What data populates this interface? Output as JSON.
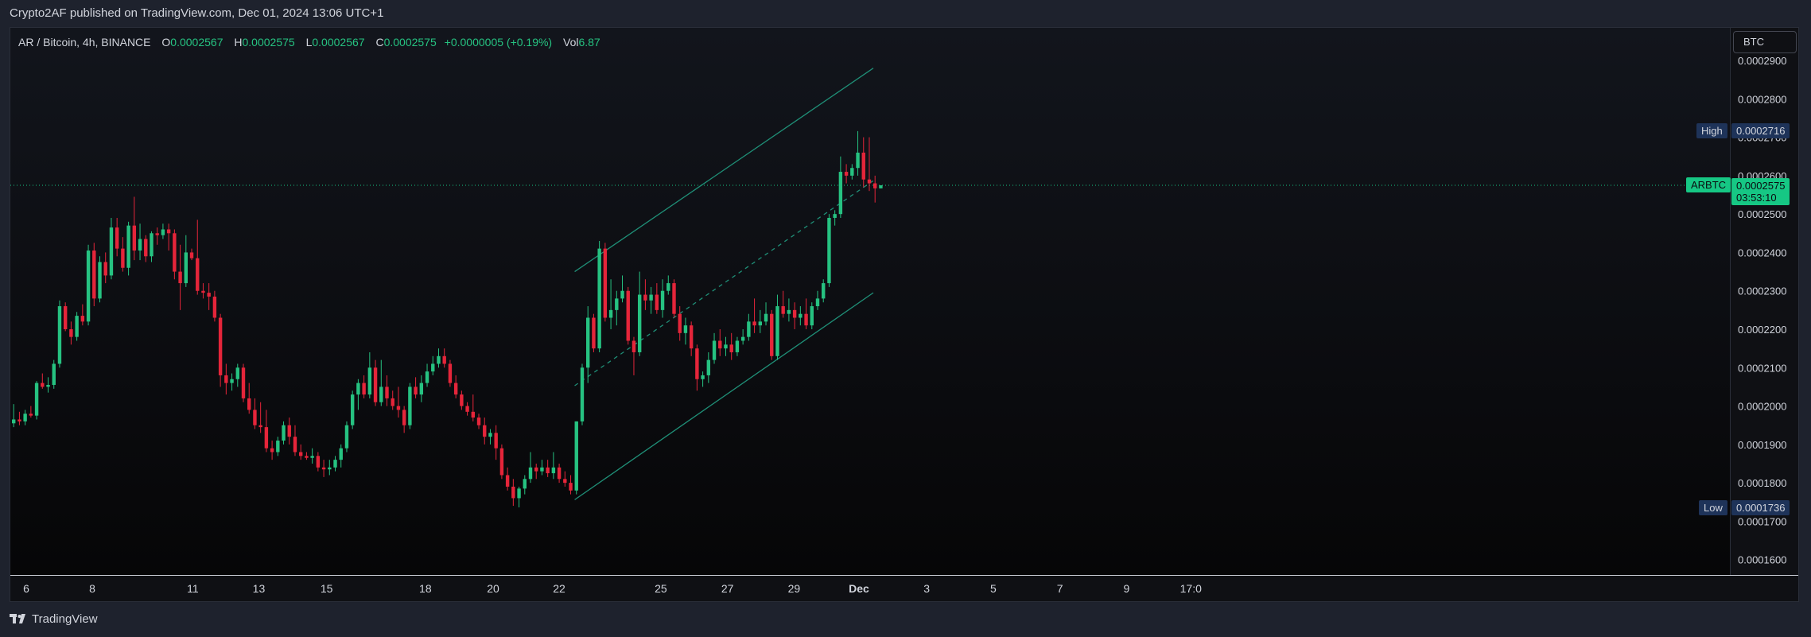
{
  "header": {
    "publish_text": "Crypto2AF published on TradingView.com, Dec 01, 2024 13:06 UTC+1"
  },
  "legend": {
    "symbol": "AR / Bitcoin, 4h, BINANCE",
    "open_label": "O",
    "open": "0.0002567",
    "high_label": "H",
    "high": "0.0002575",
    "low_label": "L",
    "low": "0.0002567",
    "close_label": "C",
    "close": "0.0002575",
    "change": "+0.0000005 (+0.19%)",
    "vol_label": "Vol",
    "vol": "6.87"
  },
  "price_axis": {
    "unit_button": "BTC"
  },
  "markers": {
    "high_label": "High",
    "high_value": "0.0002716",
    "low_label": "Low",
    "low_value": "0.0001736",
    "last_label": "ARBTC",
    "last_value": "0.0002575",
    "countdown": "03:53:10"
  },
  "colors": {
    "up": "#26c281",
    "down": "#e5253a",
    "channel": "#1f8f77",
    "last_price": "#16c784",
    "marker_bg": "#1e3359"
  },
  "footer": {
    "brand": "TradingView"
  },
  "chart_data": {
    "type": "candlestick",
    "interval": "4h",
    "symbol": "ARBTC",
    "ylim": [
      0.000156,
      0.0002985
    ],
    "y_ticks": [
      "0.0002900",
      "0.0002800",
      "0.0002700",
      "0.0002600",
      "0.0002500",
      "0.0002400",
      "0.0002300",
      "0.0002200",
      "0.0002100",
      "0.0002000",
      "0.0001900",
      "0.0001800",
      "0.0001700",
      "0.0001600"
    ],
    "x_ticks": [
      "6",
      "8",
      "11",
      "13",
      "15",
      "18",
      "20",
      "22",
      "25",
      "27",
      "29",
      "Dec",
      "3",
      "5",
      "7",
      "9",
      "17:0"
    ],
    "high": 0.0002716,
    "low": 0.0001736,
    "last": 0.0002575,
    "grid": false,
    "candles": [
      [
        0.0001955,
        0.0002005,
        0.0001945,
        0.0001965
      ],
      [
        0.0001965,
        0.0001985,
        0.000195,
        0.000196
      ],
      [
        0.000196,
        0.000199,
        0.000195,
        0.000198
      ],
      [
        0.000198,
        0.0002,
        0.000197,
        0.0001975
      ],
      [
        0.0001975,
        0.0002065,
        0.0001965,
        0.000206
      ],
      [
        0.000206,
        0.0002085,
        0.0002045,
        0.000205
      ],
      [
        0.000205,
        0.0002075,
        0.0002035,
        0.0002055
      ],
      [
        0.0002055,
        0.000212,
        0.0002045,
        0.000211
      ],
      [
        0.000211,
        0.0002275,
        0.00021,
        0.000226
      ],
      [
        0.000226,
        0.000227,
        0.0002195,
        0.00022
      ],
      [
        0.00022,
        0.000222,
        0.000216,
        0.000218
      ],
      [
        0.000218,
        0.0002245,
        0.000217,
        0.0002235
      ],
      [
        0.0002235,
        0.0002265,
        0.000221,
        0.000222
      ],
      [
        0.000222,
        0.000242,
        0.000221,
        0.0002405
      ],
      [
        0.0002405,
        0.0002425,
        0.000226,
        0.000228
      ],
      [
        0.000228,
        0.000239,
        0.000227,
        0.0002375
      ],
      [
        0.0002375,
        0.00024,
        0.000232,
        0.000234
      ],
      [
        0.000234,
        0.000249,
        0.000233,
        0.0002465
      ],
      [
        0.0002465,
        0.000249,
        0.000239,
        0.000241
      ],
      [
        0.000241,
        0.000244,
        0.000235,
        0.000236
      ],
      [
        0.000236,
        0.000248,
        0.000234,
        0.000247
      ],
      [
        0.000247,
        0.0002545,
        0.000238,
        0.0002405
      ],
      [
        0.0002405,
        0.0002475,
        0.000238,
        0.0002435
      ],
      [
        0.0002435,
        0.0002445,
        0.0002375,
        0.000239
      ],
      [
        0.000239,
        0.0002455,
        0.0002375,
        0.000245
      ],
      [
        0.000245,
        0.0002465,
        0.000242,
        0.0002445
      ],
      [
        0.0002445,
        0.0002475,
        0.0002435,
        0.000246
      ],
      [
        0.000246,
        0.0002475,
        0.0002405,
        0.000245
      ],
      [
        0.000245,
        0.000246,
        0.000233,
        0.000235
      ],
      [
        0.000235,
        0.000242,
        0.000225,
        0.000232
      ],
      [
        0.000232,
        0.0002445,
        0.000231,
        0.00024
      ],
      [
        0.00024,
        0.000241,
        0.000238,
        0.0002385
      ],
      [
        0.0002385,
        0.0002485,
        0.000229,
        0.00023
      ],
      [
        0.00023,
        0.000232,
        0.000228,
        0.0002295
      ],
      [
        0.0002295,
        0.000232,
        0.000225,
        0.0002285
      ],
      [
        0.0002285,
        0.00023,
        0.000222,
        0.000223
      ],
      [
        0.000223,
        0.000224,
        0.000205,
        0.000208
      ],
      [
        0.000208,
        0.000211,
        0.000203,
        0.000206
      ],
      [
        0.000206,
        0.0002085,
        0.000204,
        0.000207
      ],
      [
        0.000207,
        0.000211,
        0.000205,
        0.00021
      ],
      [
        0.00021,
        0.000211,
        0.000201,
        0.000202
      ],
      [
        0.000202,
        0.000206,
        0.000198,
        0.000199
      ],
      [
        0.000199,
        0.000202,
        0.000194,
        0.000195
      ],
      [
        0.000195,
        0.000201,
        0.000193,
        0.0001945
      ],
      [
        0.0001945,
        0.000199,
        0.000188,
        0.000189
      ],
      [
        0.000189,
        0.000191,
        0.000186,
        0.000188
      ],
      [
        0.000188,
        0.000192,
        0.000187,
        0.000191
      ],
      [
        0.000191,
        0.000196,
        0.00019,
        0.000195
      ],
      [
        0.000195,
        0.000197,
        0.00019,
        0.000192
      ],
      [
        0.000192,
        0.000195,
        0.000187,
        0.000188
      ],
      [
        0.000188,
        0.00019,
        0.000186,
        0.000187
      ],
      [
        0.000187,
        0.000188,
        0.000186,
        0.0001865
      ],
      [
        0.0001865,
        0.000189,
        0.000185,
        0.000187
      ],
      [
        0.000187,
        0.000188,
        0.000183,
        0.000184
      ],
      [
        0.000184,
        0.000186,
        0.0001815,
        0.0001835
      ],
      [
        0.0001835,
        0.000186,
        0.000182,
        0.000184
      ],
      [
        0.000184,
        0.000187,
        0.000183,
        0.000186
      ],
      [
        0.000186,
        0.00019,
        0.000184,
        0.000189
      ],
      [
        0.000189,
        0.000196,
        0.000188,
        0.000195
      ],
      [
        0.000195,
        0.000204,
        0.000194,
        0.000203
      ],
      [
        0.000203,
        0.000207,
        0.000199,
        0.000206
      ],
      [
        0.000206,
        0.000208,
        0.000202,
        0.000203
      ],
      [
        0.000203,
        0.000214,
        0.000202,
        0.00021
      ],
      [
        0.00021,
        0.000212,
        0.0002,
        0.000201
      ],
      [
        0.000201,
        0.000212,
        0.0002,
        0.000205
      ],
      [
        0.000205,
        0.000208,
        0.0002,
        0.000202
      ],
      [
        0.000202,
        0.000204,
        0.000199,
        0.0002
      ],
      [
        0.0002,
        0.000205,
        0.000197,
        0.000199
      ],
      [
        0.000199,
        0.0002,
        0.000193,
        0.000195
      ],
      [
        0.000195,
        0.000206,
        0.000194,
        0.000205
      ],
      [
        0.000205,
        0.0002075,
        0.000202,
        0.000203
      ],
      [
        0.000203,
        0.000208,
        0.000201,
        0.000206
      ],
      [
        0.000206,
        0.000211,
        0.000205,
        0.000209
      ],
      [
        0.000209,
        0.000213,
        0.000208,
        0.000211
      ],
      [
        0.000211,
        0.000215,
        0.00021,
        0.000213
      ],
      [
        0.000213,
        0.000215,
        0.00021,
        0.000211
      ],
      [
        0.000211,
        0.000212,
        0.000205,
        0.000206
      ],
      [
        0.000206,
        0.000208,
        0.000202,
        0.000203
      ],
      [
        0.000203,
        0.000204,
        0.000199,
        0.0002
      ],
      [
        0.0002,
        0.000201,
        0.0001975,
        0.0001985
      ],
      [
        0.0001985,
        0.000203,
        0.000196,
        0.000197
      ],
      [
        0.000197,
        0.000198,
        0.000194,
        0.000195
      ],
      [
        0.000195,
        0.000197,
        0.00019,
        0.000192
      ],
      [
        0.000192,
        0.000194,
        0.00019,
        0.000193
      ],
      [
        0.000193,
        0.000195,
        0.000186,
        0.000189
      ],
      [
        0.000189,
        0.00019,
        0.000181,
        0.000182
      ],
      [
        0.000182,
        0.000184,
        0.000178,
        0.000179
      ],
      [
        0.000179,
        0.000181,
        0.000174,
        0.000176
      ],
      [
        0.000176,
        0.000179,
        0.0001736,
        0.0001785
      ],
      [
        0.0001785,
        0.000182,
        0.000177,
        0.000181
      ],
      [
        0.000181,
        0.000188,
        0.00018,
        0.000184
      ],
      [
        0.000184,
        0.000185,
        0.000181,
        0.000183
      ],
      [
        0.000183,
        0.000186,
        0.000182,
        0.000184
      ],
      [
        0.000184,
        0.000186,
        0.0001815,
        0.0001825
      ],
      [
        0.0001825,
        0.000188,
        0.000181,
        0.000184
      ],
      [
        0.000184,
        0.000185,
        0.00018,
        0.000181
      ],
      [
        0.000181,
        0.000183,
        0.000179,
        0.00018
      ],
      [
        0.00018,
        0.000182,
        0.000177,
        0.000178
      ],
      [
        0.000178,
        0.000196,
        0.000177,
        0.000196
      ],
      [
        0.000196,
        0.000211,
        0.000195,
        0.00021
      ],
      [
        0.00021,
        0.000226,
        0.000206,
        0.000223
      ],
      [
        0.000223,
        0.000224,
        0.000214,
        0.000215
      ],
      [
        0.000215,
        0.000243,
        0.000214,
        0.000241
      ],
      [
        0.000241,
        0.0002425,
        0.000222,
        0.000223
      ],
      [
        0.000223,
        0.000233,
        0.00022,
        0.000225
      ],
      [
        0.000225,
        0.00023,
        0.000221,
        0.000228
      ],
      [
        0.000228,
        0.000234,
        0.000227,
        0.00023
      ],
      [
        0.00023,
        0.000231,
        0.000216,
        0.000217
      ],
      [
        0.000217,
        0.000218,
        0.000208,
        0.000214
      ],
      [
        0.000214,
        0.000235,
        0.000213,
        0.000229
      ],
      [
        0.000229,
        0.000233,
        0.000225,
        0.0002275
      ],
      [
        0.0002275,
        0.000231,
        0.000224,
        0.000229
      ],
      [
        0.000229,
        0.000232,
        0.000224,
        0.000225
      ],
      [
        0.000225,
        0.000233,
        0.000223,
        0.00023
      ],
      [
        0.00023,
        0.000234,
        0.000229,
        0.000232
      ],
      [
        0.000232,
        0.000233,
        0.000223,
        0.000224
      ],
      [
        0.000224,
        0.000226,
        0.000217,
        0.000219
      ],
      [
        0.000219,
        0.000223,
        0.000216,
        0.000221
      ],
      [
        0.000221,
        0.000222,
        0.000213,
        0.000215
      ],
      [
        0.000215,
        0.000216,
        0.000204,
        0.000207
      ],
      [
        0.000207,
        0.000209,
        0.000205,
        0.000208
      ],
      [
        0.000208,
        0.000214,
        0.000206,
        0.000212
      ],
      [
        0.000212,
        0.000219,
        0.000211,
        0.000217
      ],
      [
        0.000217,
        0.00022,
        0.000213,
        0.000215
      ],
      [
        0.000215,
        0.000218,
        0.000213,
        0.000216
      ],
      [
        0.000216,
        0.000219,
        0.000212,
        0.000214
      ],
      [
        0.000214,
        0.000218,
        0.000213,
        0.000217
      ],
      [
        0.000217,
        0.00022,
        0.000216,
        0.000218
      ],
      [
        0.000218,
        0.000224,
        0.000217,
        0.000222
      ],
      [
        0.000222,
        0.000228,
        0.000219,
        0.000221
      ],
      [
        0.000221,
        0.000225,
        0.000219,
        0.000222
      ],
      [
        0.000222,
        0.000227,
        0.000221,
        0.000224
      ],
      [
        0.000224,
        0.000225,
        0.000212,
        0.000213
      ],
      [
        0.000213,
        0.000229,
        0.000212,
        0.000226
      ],
      [
        0.000226,
        0.00023,
        0.000223,
        0.000224
      ],
      [
        0.000224,
        0.000228,
        0.000222,
        0.000225
      ],
      [
        0.000225,
        0.000227,
        0.00022,
        0.000223
      ],
      [
        0.000223,
        0.000226,
        0.000221,
        0.000224
      ],
      [
        0.000224,
        0.000228,
        0.00022,
        0.000221
      ],
      [
        0.000221,
        0.000227,
        0.00022,
        0.000226
      ],
      [
        0.000226,
        0.00023,
        0.000225,
        0.000228
      ],
      [
        0.000228,
        0.000233,
        0.000227,
        0.000232
      ],
      [
        0.000232,
        0.00025,
        0.000231,
        0.000249
      ],
      [
        0.000249,
        0.000251,
        0.000247,
        0.00025
      ],
      [
        0.00025,
        0.000265,
        0.000249,
        0.000261
      ],
      [
        0.000261,
        0.000263,
        0.000258,
        0.00026
      ],
      [
        0.00026,
        0.000263,
        0.000259,
        0.000262
      ],
      [
        0.000262,
        0.0002716,
        0.00026,
        0.000266
      ],
      [
        0.000266,
        0.00027,
        0.000257,
        0.000259
      ],
      [
        0.000259,
        0.00027,
        0.000256,
        0.000258
      ],
      [
        0.000258,
        0.00026,
        0.000253,
        0.0002567
      ],
      [
        0.0002567,
        0.0002575,
        0.0002567,
        0.0002575
      ]
    ],
    "channel": {
      "upper": [
        [
          98,
          0.000235
        ],
        [
          150,
          0.000288
        ]
      ],
      "lower": [
        [
          98,
          0.0001756
        ],
        [
          150,
          0.0002295
        ]
      ],
      "mid": [
        [
          98,
          0.0002053
        ],
        [
          150,
          0.0002587
        ]
      ]
    }
  }
}
